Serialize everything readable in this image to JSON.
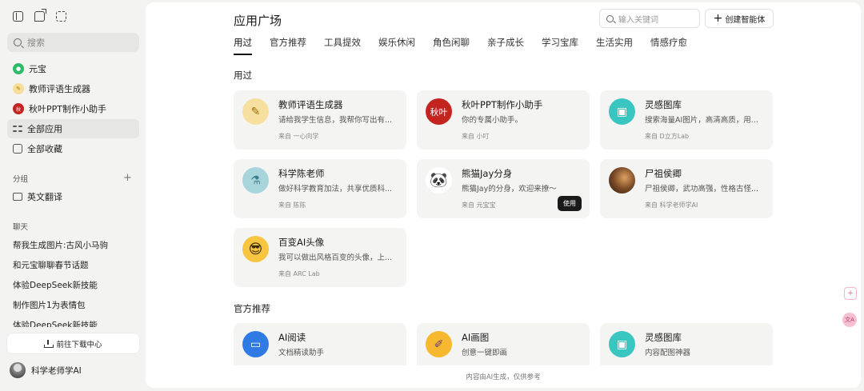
{
  "sidebar": {
    "search_placeholder": "搜索",
    "nav": [
      {
        "label": "元宝",
        "icon": "yuanbao-logo-icon",
        "color": "#2dbb6a"
      },
      {
        "label": "教师评语生成器",
        "icon": "pen-paper-icon",
        "color": "#f5cf73"
      },
      {
        "label": "秋叶PPT制作小助手",
        "icon": "qiuye-logo-icon",
        "color": "#c4241f"
      },
      {
        "label": "全部应用",
        "icon": "grid-icon"
      },
      {
        "label": "全部收藏",
        "icon": "bookmark-icon"
      }
    ],
    "groups_label": "分组",
    "groups": [
      {
        "label": "英文翻译",
        "icon": "folder-icon"
      }
    ],
    "chats_label": "聊天",
    "chats": [
      "帮我生成图片:古风小马驹",
      "和元宝聊聊春节话题",
      "体验DeepSeek新技能",
      "制作图片1为表情包",
      "体验DeepSeek新技能"
    ],
    "download_label": "前往下载中心",
    "user_name": "科学老师学AI"
  },
  "header": {
    "title": "应用广场",
    "search_placeholder": "输入关键词",
    "create_label": "创建智能体"
  },
  "tabs": [
    "用过",
    "官方推荐",
    "工具提效",
    "娱乐休闲",
    "角色闲聊",
    "亲子成长",
    "学习宝库",
    "生活实用",
    "情感疗愈"
  ],
  "active_tab": "用过",
  "sections": {
    "used": {
      "title": "用过",
      "cards": [
        {
          "name": "教师评语生成器",
          "desc": "请给我学生信息，我帮你写出有...",
          "source": "来自 一心向学",
          "icon": "pen-paper-icon",
          "color": "#f5d27a"
        },
        {
          "name": "秋叶PPT制作小助手",
          "desc": "你的专属小助手。",
          "source": "来自 小叮",
          "icon": "qiuye-logo-icon",
          "color": "#c4241f",
          "glyph": "秋叶"
        },
        {
          "name": "灵感图库",
          "desc": "搜索海量AI图片，高清高质，用...",
          "source": "来自 D立方Lab",
          "icon": "image-gallery-icon",
          "color": "#39c5c0"
        },
        {
          "name": "科学陈老师",
          "desc": "做好科学教育加法，共享优质科...",
          "source": "来自 陈陈",
          "icon": "science-flasks-icon",
          "color": "#9fd0d8"
        },
        {
          "name": "熊猫Jay分身",
          "desc": "熊猫Jay的分身，欢迎来撩～",
          "source": "来自 元宝宝",
          "icon": "panda-icon",
          "color": "#ffffff",
          "use_label": "使用"
        },
        {
          "name": "尸祖侯卿",
          "desc": "尸祖侯卿，武功高强，性格古怪...",
          "source": "来自 科学老师学AI",
          "icon": "warrior-portrait-icon",
          "color": "#7a4a26"
        },
        {
          "name": "百变AI头像",
          "desc": "我可以做出风格百变的头像，上...",
          "source": "来自 ARC Lab",
          "icon": "cool-emoji-icon",
          "color": "#f7c540"
        }
      ]
    },
    "official": {
      "title": "官方推荐",
      "cards": [
        {
          "name": "AI阅读",
          "desc": "文档精读助手",
          "icon": "reader-icon",
          "color": "#2f7ae5"
        },
        {
          "name": "AI画图",
          "desc": "创意一键即画",
          "icon": "paint-icon",
          "color": "#f5b82e"
        },
        {
          "name": "灵感图库",
          "desc": "内容配图神器",
          "icon": "image-gallery-icon",
          "color": "#39c5c0"
        }
      ]
    }
  },
  "footer_note": "内容由AI生成，仅供参考",
  "floating": [
    {
      "icon": "add-widget-icon",
      "color": "#e8618c"
    },
    {
      "icon": "translate-icon",
      "color": "#e8618c",
      "glyph": "文A"
    }
  ]
}
